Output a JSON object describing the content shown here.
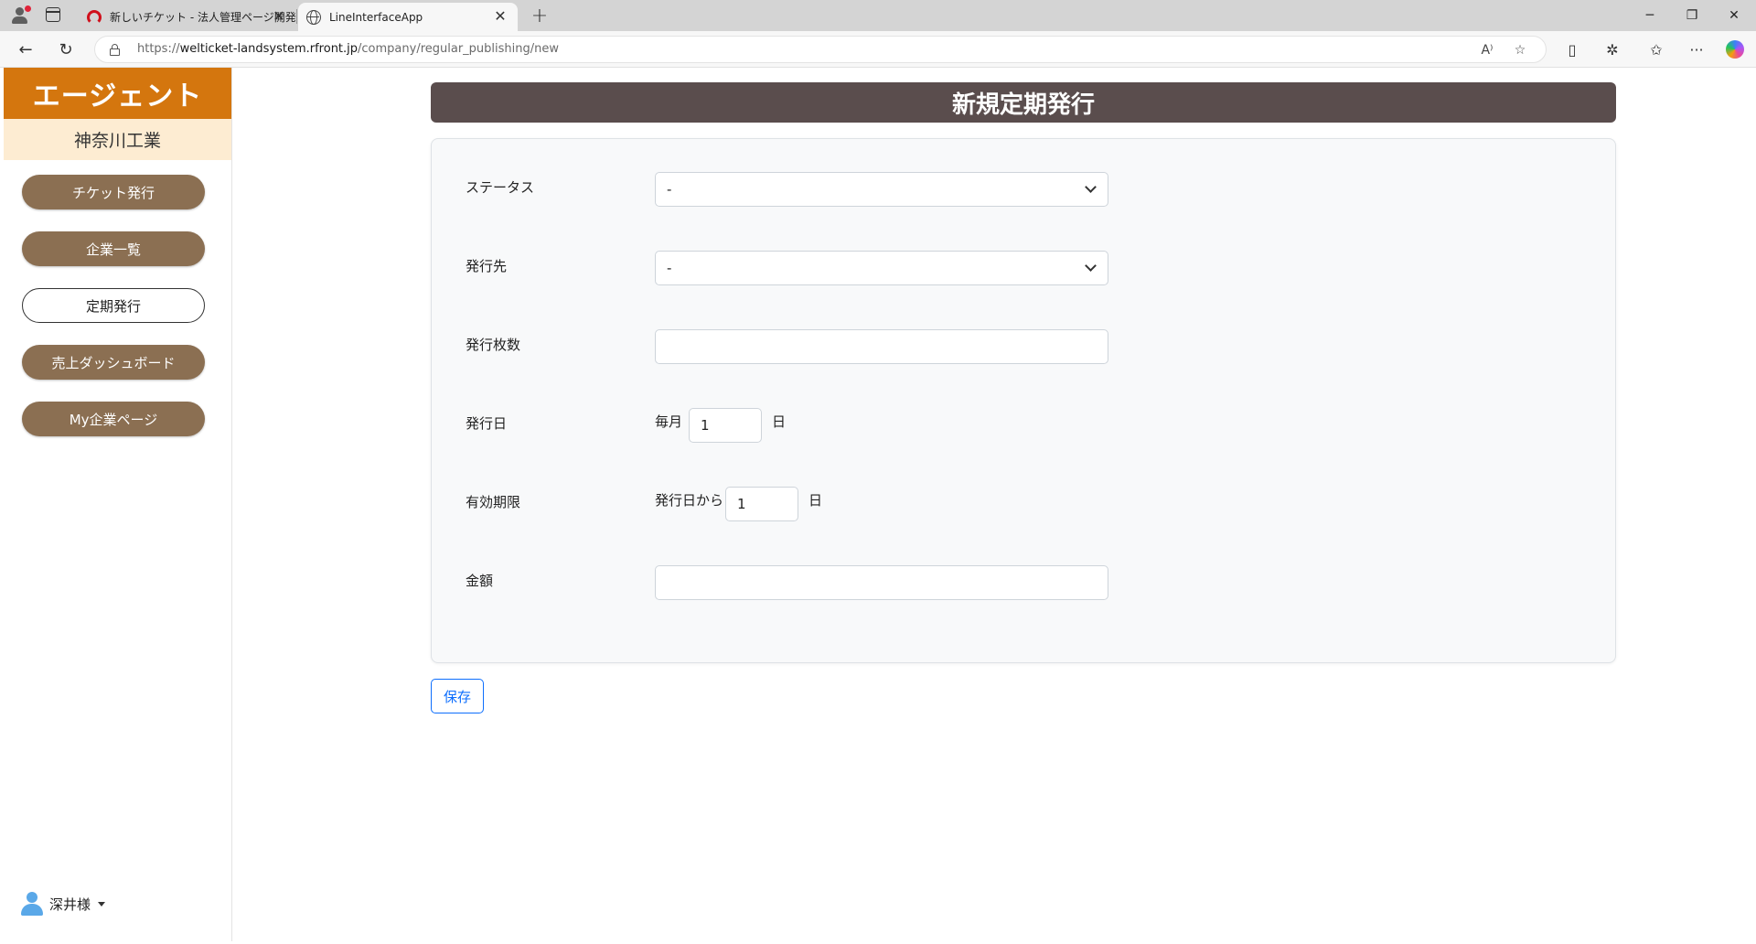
{
  "browser": {
    "tabs": [
      {
        "title": "新しいチケット - 法人管理ページ開発"
      },
      {
        "title": "LineInterfaceApp"
      }
    ],
    "url_prefix": "https://",
    "url_host": "welticket-landsystem.rfront.jp",
    "url_path": "/company/regular_publishing/new"
  },
  "sidebar": {
    "brand": "エージェント",
    "company": "神奈川工業",
    "items": [
      {
        "label": "チケット発行",
        "active": false
      },
      {
        "label": "企業一覧",
        "active": false
      },
      {
        "label": "定期発行",
        "active": true
      },
      {
        "label": "売上ダッシュボード",
        "active": false
      },
      {
        "label": "My企業ページ",
        "active": false
      }
    ],
    "user": "深井様"
  },
  "page": {
    "title": "新規定期発行"
  },
  "form": {
    "status": {
      "label": "ステータス",
      "value": "-"
    },
    "destination": {
      "label": "発行先",
      "value": "-"
    },
    "quantity": {
      "label": "発行枚数",
      "value": ""
    },
    "issue_day": {
      "label": "発行日",
      "prefix": "毎月",
      "value": "1",
      "suffix": "日"
    },
    "expiry": {
      "label": "有効期限",
      "prefix": "発行日から",
      "value": "1",
      "suffix": "日"
    },
    "amount": {
      "label": "金額",
      "value": ""
    },
    "save_label": "保存"
  }
}
